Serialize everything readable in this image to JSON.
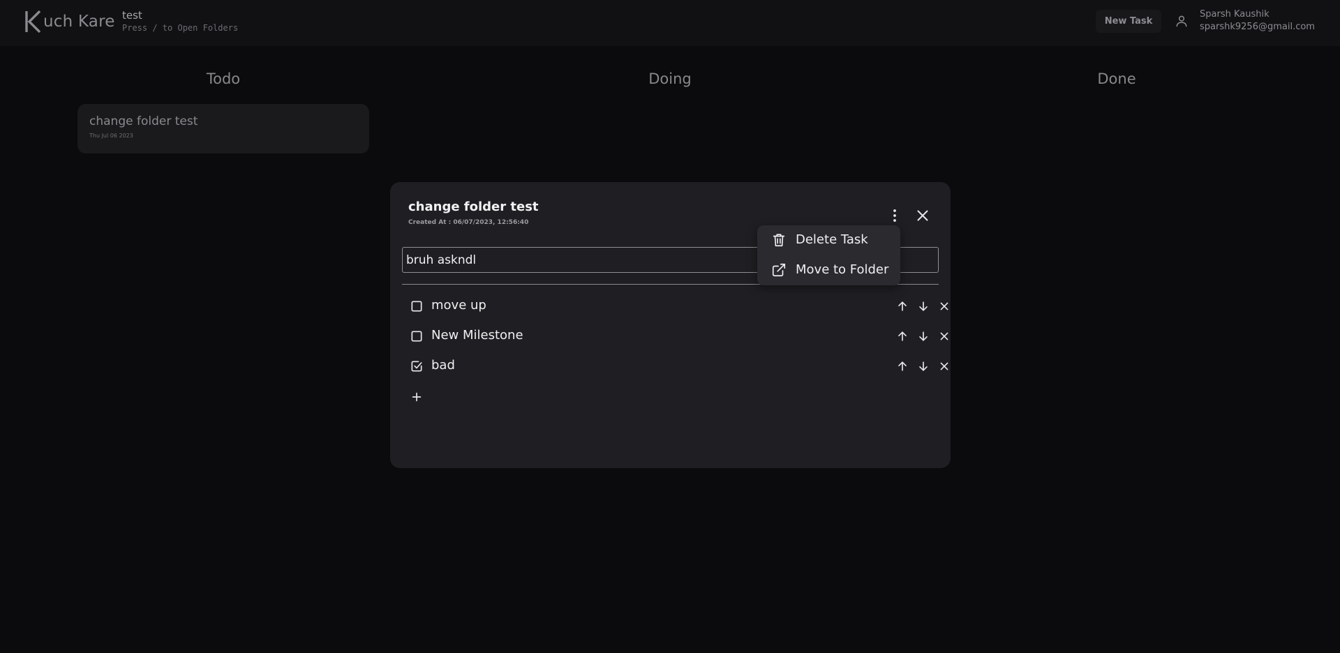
{
  "header": {
    "logo_letter": "K",
    "logo_text": "uch Kare",
    "folder_name": "test",
    "folder_hint": "Press / to Open Folders",
    "new_task_label": "New Task",
    "user_icon": "user-icon",
    "user_name": "Sparsh Kaushik",
    "user_email": "sparshk9256@gmail.com"
  },
  "board": {
    "columns": [
      {
        "title": "Todo"
      },
      {
        "title": "Doing"
      },
      {
        "title": "Done"
      }
    ],
    "todo_cards": [
      {
        "title": "change folder test",
        "date": "Thu Jul 06 2023"
      }
    ]
  },
  "modal": {
    "title": "change folder test",
    "created_at": "Created At : 06/07/2023, 12:56:40",
    "menu_icon": "more-vertical-icon",
    "close_icon": "close-icon",
    "description_value": "bruh askndl",
    "milestones": [
      {
        "label": "move up",
        "checked": false
      },
      {
        "label": "New Milestone",
        "checked": false
      },
      {
        "label": "bad",
        "checked": true
      }
    ],
    "add_icon": "plus-icon"
  },
  "menu": {
    "items": [
      {
        "label": "Delete Task",
        "icon": "trash-icon"
      },
      {
        "label": "Move to Folder",
        "icon": "external-link-icon"
      }
    ]
  },
  "colors": {
    "background": "#0b0b0d",
    "header": "#111114",
    "modal": "#1f1f23",
    "card": "#1a1a1d",
    "menu": "#2a2a2f"
  }
}
